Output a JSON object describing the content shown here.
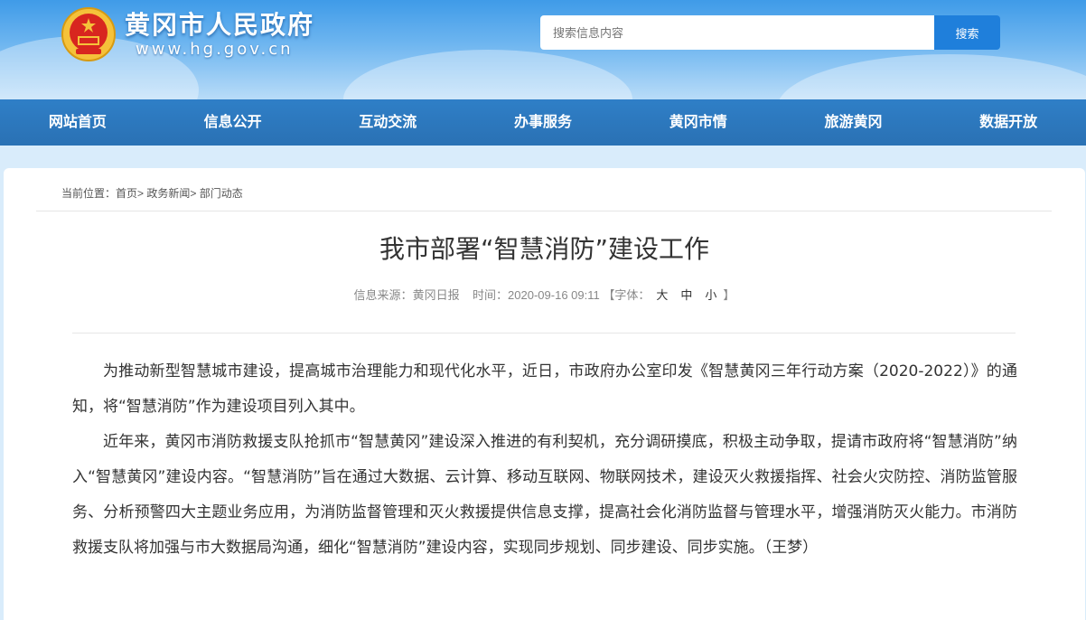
{
  "header": {
    "site_title": "黄冈市人民政府",
    "site_url": "www.hg.gov.cn",
    "search_placeholder": "搜索信息内容",
    "search_button": "搜索"
  },
  "nav": {
    "items": [
      "网站首页",
      "信息公开",
      "互动交流",
      "办事服务",
      "黄冈市情",
      "旅游黄冈",
      "数据开放"
    ]
  },
  "breadcrumb": {
    "prefix": "当前位置：",
    "items": [
      "首页",
      "政务新闻",
      "部门动态"
    ],
    "separator": ">"
  },
  "article": {
    "title": "我市部署“智慧消防”建设工作",
    "source_label": "信息来源：",
    "source": "黄冈日报",
    "time_label": "时间：",
    "time": "2020-09-16 09:11",
    "font_size_label": "【字体：",
    "font_size_options": [
      "大",
      "中",
      "小"
    ],
    "font_size_close": "】",
    "paragraphs": [
      "为推动新型智慧城市建设，提高城市治理能力和现代化水平，近日，市政府办公室印发《智慧黄冈三年行动方案（2020-2022）》的通知，将“智慧消防”作为建设项目列入其中。",
      "近年来，黄冈市消防救援支队抢抓市“智慧黄冈”建设深入推进的有利契机，充分调研摸底，积极主动争取，提请市政府将“智慧消防”纳入“智慧黄冈”建设内容。“智慧消防”旨在通过大数据、云计算、移动互联网、物联网技术，建设灭火救援指挥、社会火灾防控、消防监管服务、分析预警四大主题业务应用，为消防监督管理和灭火救援提供信息支撑，提高社会化消防监督与管理水平，增强消防灭火能力。市消防救援支队将加强与市大数据局沟通，细化“智慧消防”建设内容，实现同步规划、同步建设、同步实施。（王梦）"
    ]
  },
  "colors": {
    "nav_bg": "#2a71b4",
    "search_button_bg": "#1f7fdb",
    "banner_top": "#3f9be8"
  }
}
